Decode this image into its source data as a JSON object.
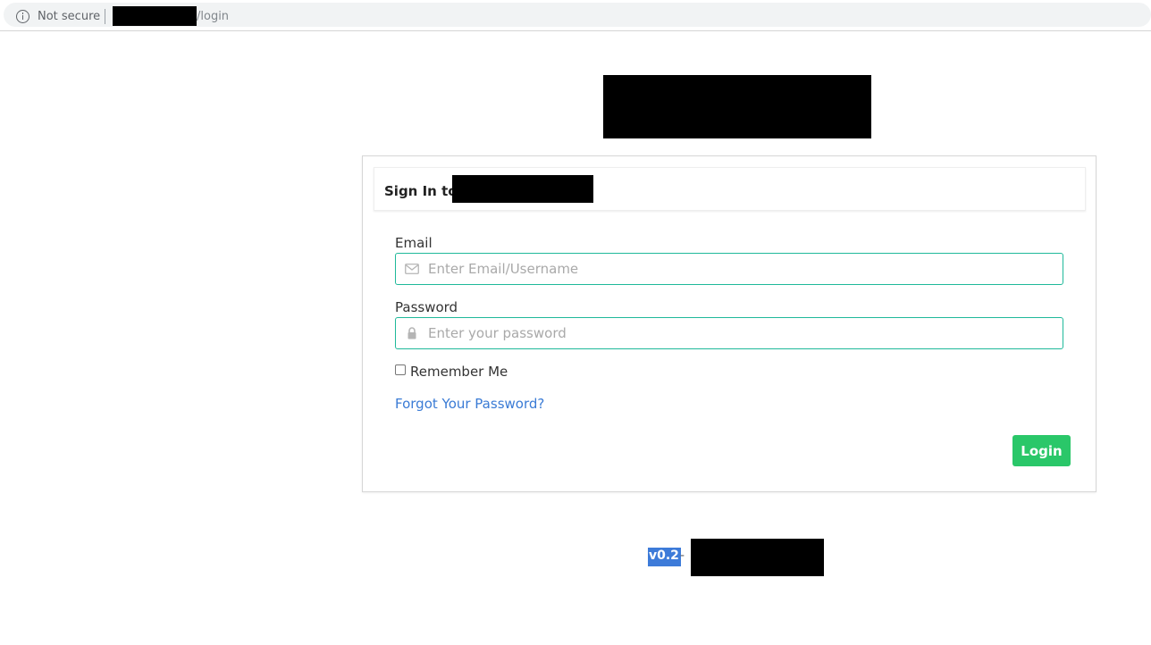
{
  "browser": {
    "security_label": "Not secure",
    "url_path": "/login"
  },
  "card": {
    "title": "Sign In to"
  },
  "form": {
    "email_label": "Email",
    "email_placeholder": "Enter Email/Username",
    "email_value": "",
    "password_label": "Password",
    "password_placeholder": "Enter your password",
    "password_value": "",
    "remember_label": "Remember Me",
    "remember_checked": false,
    "forgot_link": "Forgot Your Password?",
    "login_button": "Login"
  },
  "footer": {
    "version": "v0.2",
    "separator": "-"
  },
  "colors": {
    "accent": "#1fb99a",
    "button": "#2ac769",
    "link": "#3a7bd5"
  }
}
